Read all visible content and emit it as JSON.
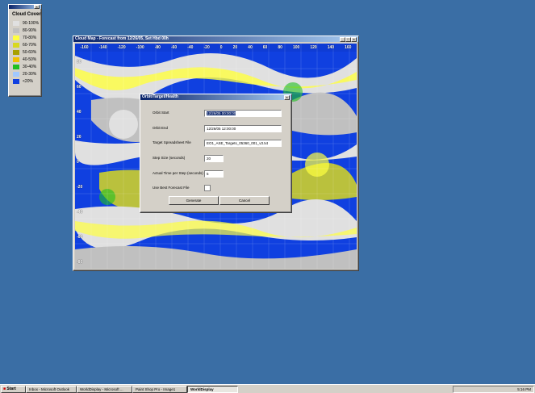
{
  "legend": {
    "title": "Cloud Cover",
    "items": [
      {
        "label": "90-100%",
        "color": "#e0e0e0"
      },
      {
        "label": "80-90%",
        "color": "#c0c0c0"
      },
      {
        "label": "70-80%",
        "color": "#ffff40"
      },
      {
        "label": "60-70%",
        "color": "#d8d820"
      },
      {
        "label": "50-60%",
        "color": "#a8a000"
      },
      {
        "label": "40-50%",
        "color": "#f0c000"
      },
      {
        "label": "30-40%",
        "color": "#20c020"
      },
      {
        "label": "20-30%",
        "color": "#a0c8ff"
      },
      {
        "label": "<20%",
        "color": "#1040e0"
      }
    ]
  },
  "map_window": {
    "title": "Cloud Map - Forecast from 12/26/05, Set Hbd 00h",
    "lon_labels": [
      "-160",
      "-140",
      "-120",
      "-100",
      "-80",
      "-60",
      "-40",
      "-20",
      "0",
      "20",
      "40",
      "60",
      "80",
      "100",
      "120",
      "140",
      "160"
    ],
    "lat_labels": [
      "80",
      "60",
      "40",
      "20",
      "0",
      "-20",
      "-40",
      "-60",
      "-80"
    ]
  },
  "dialog": {
    "title": "Orbit/Target/Health",
    "fields": {
      "orbit_start_label": "Orbit Start",
      "orbit_start_value": "12/26/05 00:00:00",
      "orbit_end_label": "Orbit End",
      "orbit_end_value": "12/26/05 12:00:00",
      "target_file_label": "Target Spreadsheet File",
      "target_file_value": "EO1_ASE_Targets_05360_001_v3.txt",
      "step_size_label": "Step Size (seconds)",
      "step_size_value": "20",
      "actual_time_label": "Actual Time per Step (seconds)",
      "actual_time_value": "5",
      "use_best_label": "Use Best Forecast File"
    },
    "generate_label": "Generate",
    "cancel_label": "Cancel"
  },
  "taskbar": {
    "start_label": "Start",
    "tasks": [
      {
        "label": "Inbox - Microsoft Outlook"
      },
      {
        "label": "WorldDisplay - Microsoft ..."
      },
      {
        "label": "Paint Shop Pro - Image1"
      },
      {
        "label": "WorldDisplay"
      }
    ],
    "clock": "5:16 PM"
  }
}
